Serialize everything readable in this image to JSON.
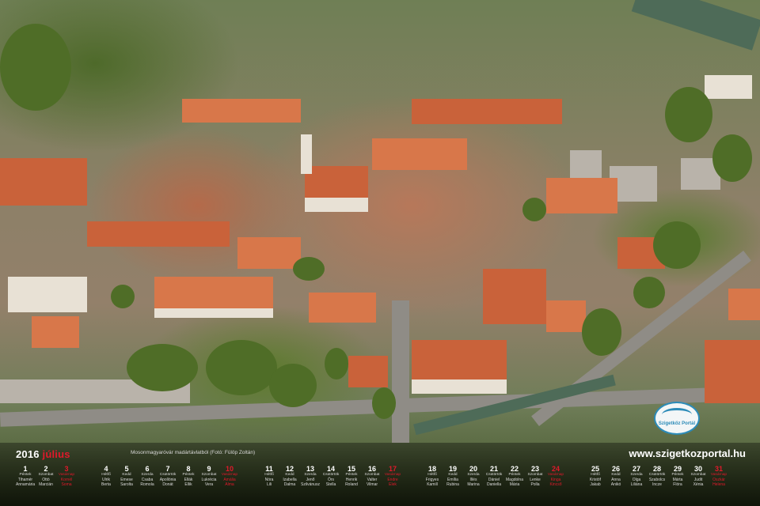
{
  "calendar": {
    "year": "2016",
    "month": "július",
    "credit": "Mosonmagyaróvár madártávlatból (Fotó: Fülöp Zoltán)",
    "website": "www.szigetkozportal.hu",
    "logo_text": "Szigetköz Portál",
    "holiday_color": "#e0192b",
    "days": [
      {
        "n": "1",
        "w": "Péntek",
        "nm": "Tihamér\nAnnamária",
        "holiday": false
      },
      {
        "n": "2",
        "w": "Szombat",
        "nm": "Ottó\nMarcián",
        "holiday": false
      },
      {
        "n": "3",
        "w": "Vasárnap",
        "nm": "Kornél\nSoma",
        "holiday": true
      },
      {
        "n": "4",
        "w": "Hétfő",
        "nm": "Ulrik\nBerta",
        "holiday": false
      },
      {
        "n": "5",
        "w": "Kedd",
        "nm": "Emese\nSarolta",
        "holiday": false
      },
      {
        "n": "6",
        "w": "Szerda",
        "nm": "Csaba\nRomola",
        "holiday": false
      },
      {
        "n": "7",
        "w": "Csütörtök",
        "nm": "Apollónia\nDonát",
        "holiday": false
      },
      {
        "n": "8",
        "w": "Péntek",
        "nm": "Ellák\nEllik",
        "holiday": false
      },
      {
        "n": "9",
        "w": "Szombat",
        "nm": "Lukrécia\nVera",
        "holiday": false
      },
      {
        "n": "10",
        "w": "Vasárnap",
        "nm": "Amália\nAlma",
        "holiday": true
      },
      {
        "n": "11",
        "w": "Hétfő",
        "nm": "Nóra\nLili",
        "holiday": false
      },
      {
        "n": "12",
        "w": "Kedd",
        "nm": "Izabella\nDalma",
        "holiday": false
      },
      {
        "n": "13",
        "w": "Szerda",
        "nm": "Jenő\nSzilvánusz",
        "holiday": false
      },
      {
        "n": "14",
        "w": "Csütörtök",
        "nm": "Őrs\nStella",
        "holiday": false
      },
      {
        "n": "15",
        "w": "Péntek",
        "nm": "Henrik\nRoland",
        "holiday": false
      },
      {
        "n": "16",
        "w": "Szombat",
        "nm": "Valter\nVilmar",
        "holiday": false
      },
      {
        "n": "17",
        "w": "Vasárnap",
        "nm": "Endre\nElek",
        "holiday": true
      },
      {
        "n": "18",
        "w": "Hétfő",
        "nm": "Frigyes\nKamill",
        "holiday": false
      },
      {
        "n": "19",
        "w": "Kedd",
        "nm": "Emília\nRubina",
        "holiday": false
      },
      {
        "n": "20",
        "w": "Szerda",
        "nm": "Illés\nMarina",
        "holiday": false
      },
      {
        "n": "21",
        "w": "Csütörtök",
        "nm": "Dániel\nDaniella",
        "holiday": false
      },
      {
        "n": "22",
        "w": "Péntek",
        "nm": "Magdolna\nMária",
        "holiday": false
      },
      {
        "n": "23",
        "w": "Szombat",
        "nm": "Lenke\nPolla",
        "holiday": false
      },
      {
        "n": "24",
        "w": "Vasárnap",
        "nm": "Kinga\nKincső",
        "holiday": true
      },
      {
        "n": "25",
        "w": "Hétfő",
        "nm": "Kristóf\nJakab",
        "holiday": false
      },
      {
        "n": "26",
        "w": "Kedd",
        "nm": "Anna\nAnikó",
        "holiday": false
      },
      {
        "n": "27",
        "w": "Szerda",
        "nm": "Olga\nLiliána",
        "holiday": false
      },
      {
        "n": "28",
        "w": "Csütörtök",
        "nm": "Szabolcs\nIncze",
        "holiday": false
      },
      {
        "n": "29",
        "w": "Péntek",
        "nm": "Márta\nFlóra",
        "holiday": false
      },
      {
        "n": "30",
        "w": "Szombat",
        "nm": "Judit\nXénia",
        "holiday": false
      },
      {
        "n": "31",
        "w": "Vasárnap",
        "nm": "Oszkár\nHelena",
        "holiday": true
      }
    ]
  }
}
